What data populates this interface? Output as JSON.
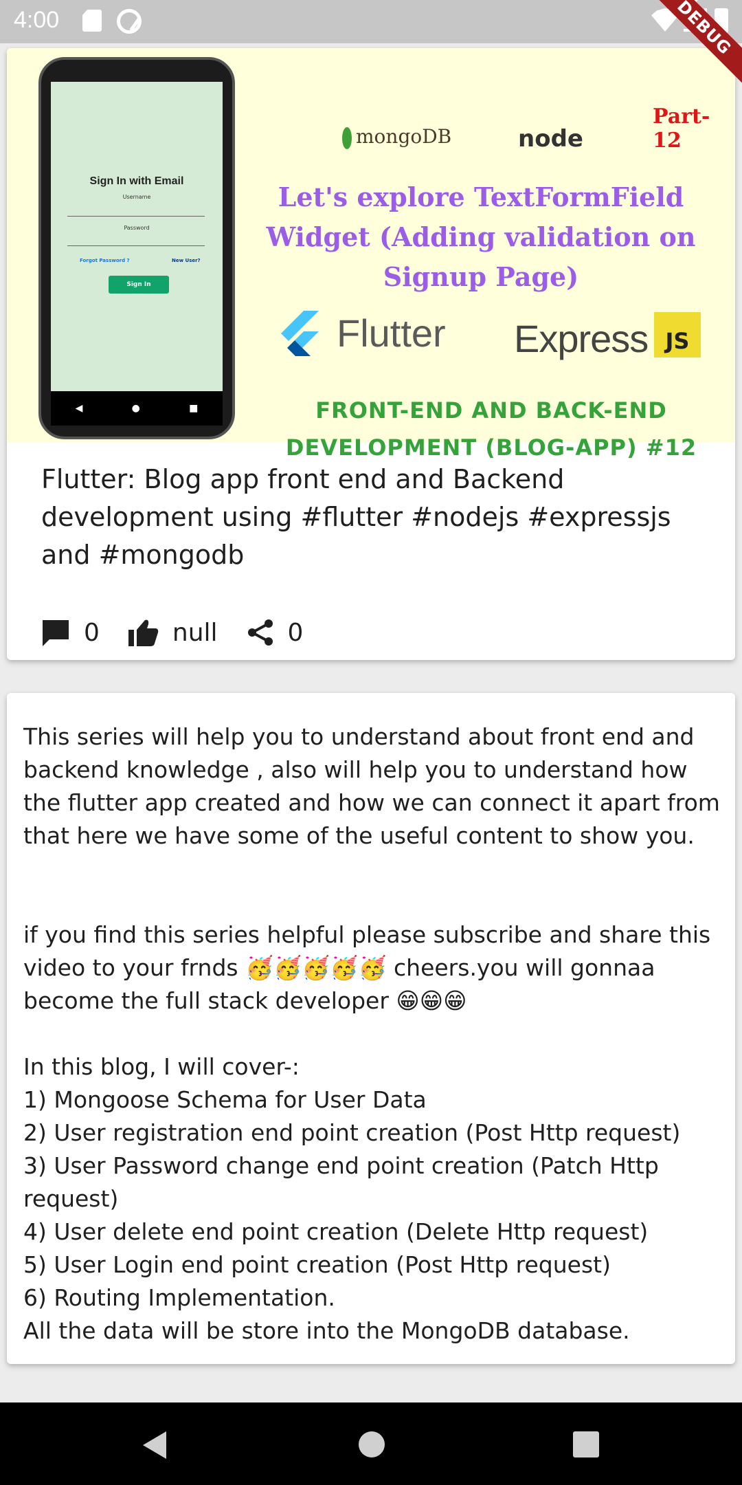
{
  "status_bar": {
    "time": "4:00"
  },
  "debug_banner": "DEBUG",
  "thumbnail": {
    "phone_screen": {
      "title": "Sign In with Email",
      "username_label": "Username",
      "password_label": "Password",
      "forgot_link": "Forgot Password ?",
      "new_user_link": "New User?",
      "sign_in_button": "Sign In",
      "nav_icons": [
        "◀",
        "●",
        "■"
      ]
    },
    "mongodb_label": "mongoDB",
    "node_label": "node",
    "part_label": "Part-12",
    "headline": "Let's explore TextFormField Widget (Adding validation on Signup Page)",
    "flutter_label": "Flutter",
    "express_label": "Express",
    "js_label": "JS",
    "subline": "FRONT-END AND BACK-END DEVELOPMENT (BLOG-APP) #12"
  },
  "post": {
    "title": "Flutter: Blog app front end and Backend development using #flutter #nodejs #expressjs and #mongodb",
    "comments_count": "0",
    "likes_count": "null",
    "shares_count": "0"
  },
  "description": "This series will help you to understand about front end and backend knowledge , also will help you to understand how the flutter app created and how we can connect it apart from that here we have some of the useful content to show you.\n\n\nif you find this series helpful please subscribe and share this video to your frnds 🥳🥳🥳🥳🥳 cheers.you will gonnaa become the full stack developer 😁😁😁\n\nIn this blog, I will cover-:\n1) Mongoose Schema for User Data\n2) User registration end point creation (Post Http request)\n3) User Password change end point creation (Patch Http request)\n4) User delete end point creation (Delete Http request)\n5) User Login end point creation (Post Http request)\n6) Routing Implementation.\nAll the data will be store into the MongoDB database.",
  "colors": {
    "banner_bg": "#ffffdc",
    "headline": "#9b5ce6",
    "subline": "#35a33a",
    "part": "#e01616",
    "debug": "#a31b1b"
  },
  "icons": {
    "comment": "comment-icon",
    "like": "thumb-up-icon",
    "share": "share-icon"
  }
}
